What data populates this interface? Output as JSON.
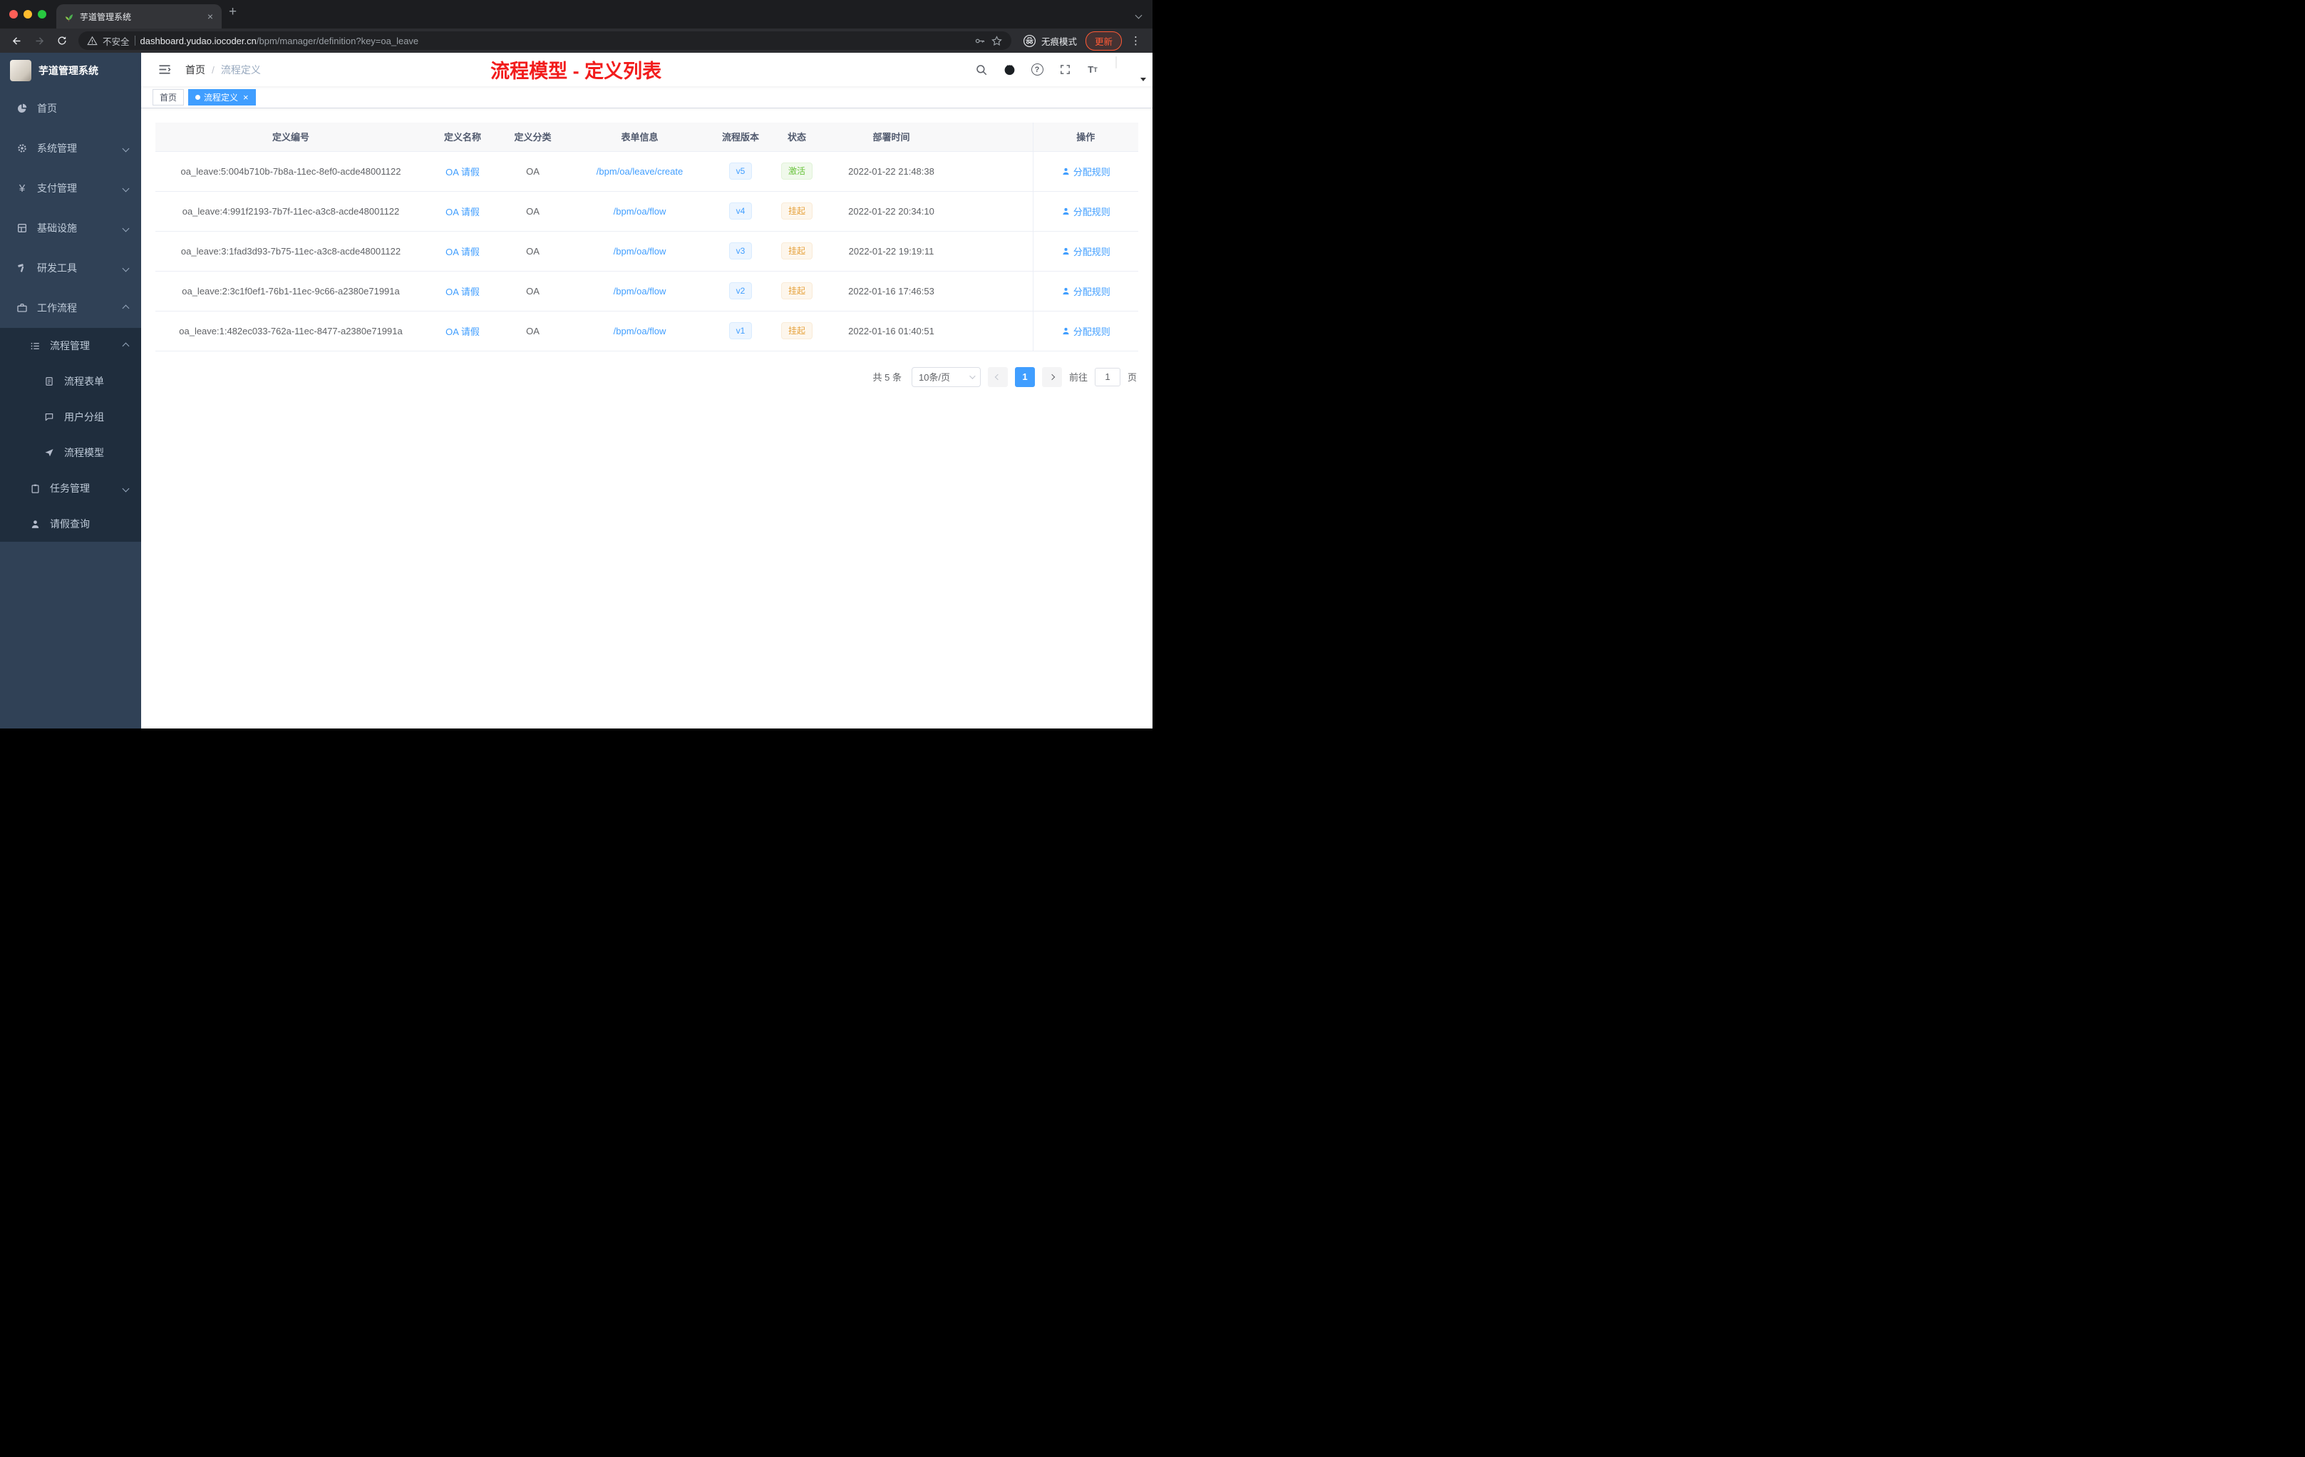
{
  "colors": {
    "accent": "#409eff",
    "success": "#67c23a",
    "warning": "#e6a23c",
    "banner_red": "#f21c1c",
    "sidebar_bg": "#304156",
    "submenu_bg": "#1f2d3d"
  },
  "browser": {
    "tab_title": "芋道管理系统",
    "security_label": "不安全",
    "url_host": "dashboard.yudao.iocoder.cn",
    "url_path": "/bpm/manager/definition?key=oa_leave",
    "incognito_label": "无痕模式",
    "update_label": "更新"
  },
  "sidebar": {
    "brand": "芋道管理系统",
    "items": [
      {
        "label": "首页"
      },
      {
        "label": "系统管理"
      },
      {
        "label": "支付管理"
      },
      {
        "label": "基础设施"
      },
      {
        "label": "研发工具"
      },
      {
        "label": "工作流程"
      }
    ],
    "workflow_children": {
      "process_mgmt": {
        "label": "流程管理"
      },
      "process_form": {
        "label": "流程表单"
      },
      "user_group": {
        "label": "用户分组"
      },
      "process_model": {
        "label": "流程模型"
      },
      "task_mgmt": {
        "label": "任务管理"
      },
      "leave_query": {
        "label": "请假查询"
      }
    }
  },
  "navbar": {
    "breadcrumb_home": "首页",
    "breadcrumb_separator": "/",
    "breadcrumb_current": "流程定义",
    "banner": "流程模型 - 定义列表"
  },
  "tags": [
    {
      "label": "首页",
      "active": false
    },
    {
      "label": "流程定义",
      "active": true
    }
  ],
  "table": {
    "headers": [
      "定义编号",
      "定义名称",
      "定义分类",
      "表单信息",
      "流程版本",
      "状态",
      "部署时间",
      "操作"
    ],
    "action_label": "分配规则",
    "rows": [
      {
        "id": "oa_leave:5:004b710b-7b8a-11ec-8ef0-acde48001122",
        "name": "OA 请假",
        "category": "OA",
        "form": "/bpm/oa/leave/create",
        "version": "v5",
        "status": "激活",
        "status_type": "success",
        "time": "2022-01-22 21:48:38"
      },
      {
        "id": "oa_leave:4:991f2193-7b7f-11ec-a3c8-acde48001122",
        "name": "OA 请假",
        "category": "OA",
        "form": "/bpm/oa/flow",
        "version": "v4",
        "status": "挂起",
        "status_type": "warning",
        "time": "2022-01-22 20:34:10"
      },
      {
        "id": "oa_leave:3:1fad3d93-7b75-11ec-a3c8-acde48001122",
        "name": "OA 请假",
        "category": "OA",
        "form": "/bpm/oa/flow",
        "version": "v3",
        "status": "挂起",
        "status_type": "warning",
        "time": "2022-01-22 19:19:11"
      },
      {
        "id": "oa_leave:2:3c1f0ef1-76b1-11ec-9c66-a2380e71991a",
        "name": "OA 请假",
        "category": "OA",
        "form": "/bpm/oa/flow",
        "version": "v2",
        "status": "挂起",
        "status_type": "warning",
        "time": "2022-01-16 17:46:53"
      },
      {
        "id": "oa_leave:1:482ec033-762a-11ec-8477-a2380e71991a",
        "name": "OA 请假",
        "category": "OA",
        "form": "/bpm/oa/flow",
        "version": "v1",
        "status": "挂起",
        "status_type": "warning",
        "time": "2022-01-16 01:40:51"
      }
    ]
  },
  "pagination": {
    "total": "共 5 条",
    "page_size": "10条/页",
    "current": "1",
    "goto_prefix": "前往",
    "goto_value": "1",
    "goto_suffix": "页"
  }
}
